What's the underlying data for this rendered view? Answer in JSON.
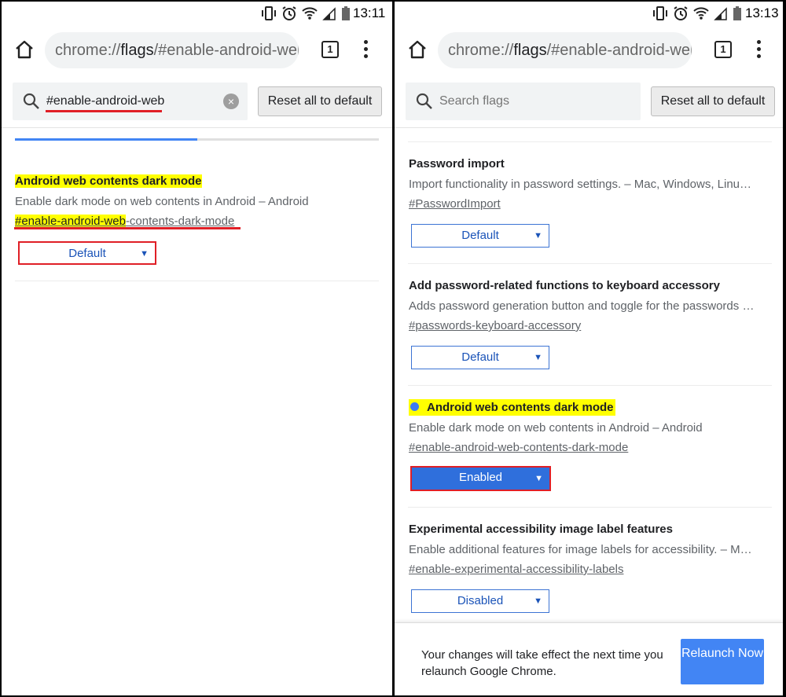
{
  "left": {
    "status_time": "13:11",
    "omnibox": {
      "prefix": "chrome://",
      "bold": "flags",
      "suffix": "/#enable-android-web-"
    },
    "tab_count": "1",
    "search": {
      "value": "#enable-android-web",
      "clear": "×"
    },
    "reset_label": "Reset all to default",
    "progress_fraction": 0.5,
    "flag": {
      "title": "Android web contents dark mode",
      "desc": "Enable dark mode on web contents in Android – Android",
      "link_highlight": "#enable-android-web",
      "link_rest": "-contents-dark-mode",
      "select_value": "Default"
    }
  },
  "right": {
    "status_time": "13:13",
    "omnibox": {
      "prefix": "chrome://",
      "bold": "flags",
      "suffix": "/#enable-android-web-"
    },
    "tab_count": "1",
    "search": {
      "placeholder": "Search flags"
    },
    "reset_label": "Reset all to default",
    "flags": [
      {
        "title": "Password import",
        "desc": "Import functionality in password settings. – Mac, Windows, Linu…",
        "link": "#PasswordImport",
        "select_value": "Default"
      },
      {
        "title": "Add password-related functions to keyboard accessory",
        "desc": "Adds password generation button and toggle for the passwords …",
        "link": "#passwords-keyboard-accessory",
        "select_value": "Default"
      },
      {
        "title": "Android web contents dark mode",
        "desc": "Enable dark mode on web contents in Android – Android",
        "link": "#enable-android-web-contents-dark-mode",
        "select_value": "Enabled"
      },
      {
        "title": "Experimental accessibility image label features",
        "desc": "Enable additional features for image labels for accessibility. – M…",
        "link": "#enable-experimental-accessibility-labels",
        "select_value": "Disabled"
      }
    ],
    "relaunch": {
      "message": "Your changes will take effect the next time you relaunch Google Chrome.",
      "button": "Relaunch Now"
    }
  },
  "icons": {
    "dropdown_arrow": "▼"
  },
  "colors": {
    "accent": "#4285f4",
    "highlight": "#ffff00",
    "annotation_red": "#e01f26",
    "enabled_blue": "#2f6fdc"
  }
}
